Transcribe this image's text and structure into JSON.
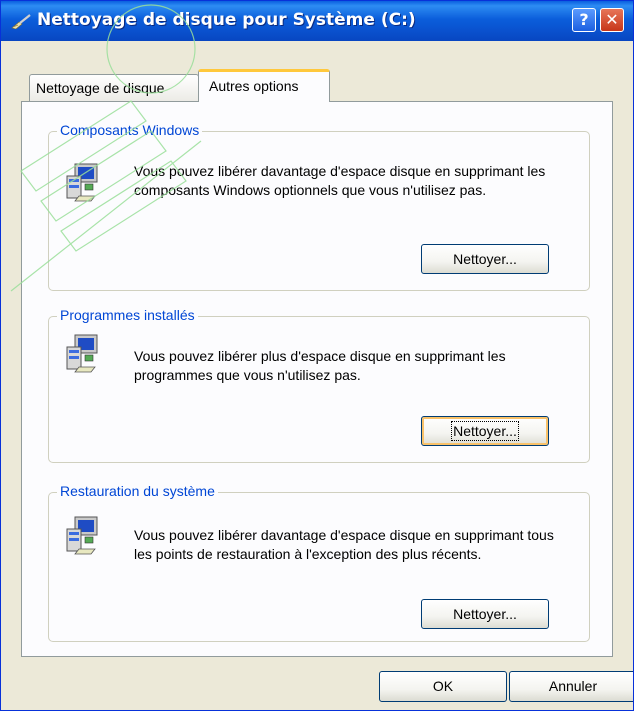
{
  "window": {
    "title": "Nettoyage de disque pour Système (C:)",
    "help_label": "?",
    "close_label": "✕",
    "icon": "disk-cleanup-broom-icon"
  },
  "tabs": [
    {
      "label": "Nettoyage de disque",
      "active": false
    },
    {
      "label": "Autres options",
      "active": true
    }
  ],
  "groups": [
    {
      "title": "Composants Windows",
      "description": "Vous pouvez libérer davantage d'espace disque en supprimant les composants Windows optionnels que vous n'utilisez pas.",
      "button": "Nettoyer...",
      "icon": "windows-setup-computer-icon"
    },
    {
      "title": "Programmes installés",
      "description": "Vous pouvez libérer plus d'espace disque en supprimant les programmes que vous n'utilisez pas.",
      "button": "Nettoyer...",
      "icon": "windows-setup-computer-icon"
    },
    {
      "title": "Restauration du système",
      "description": "Vous pouvez libérer davantage d'espace disque en supprimant tous les points de restauration à l'exception des plus récents.",
      "button": "Nettoyer...",
      "icon": "windows-setup-computer-icon"
    }
  ],
  "footer": {
    "ok_label": "OK",
    "cancel_label": "Annuler"
  },
  "colors": {
    "title_bar": "#0a53d0",
    "group_title": "#0046d5",
    "tab_highlight": "#ffc83c",
    "dialog_background": "#ece9d8"
  }
}
